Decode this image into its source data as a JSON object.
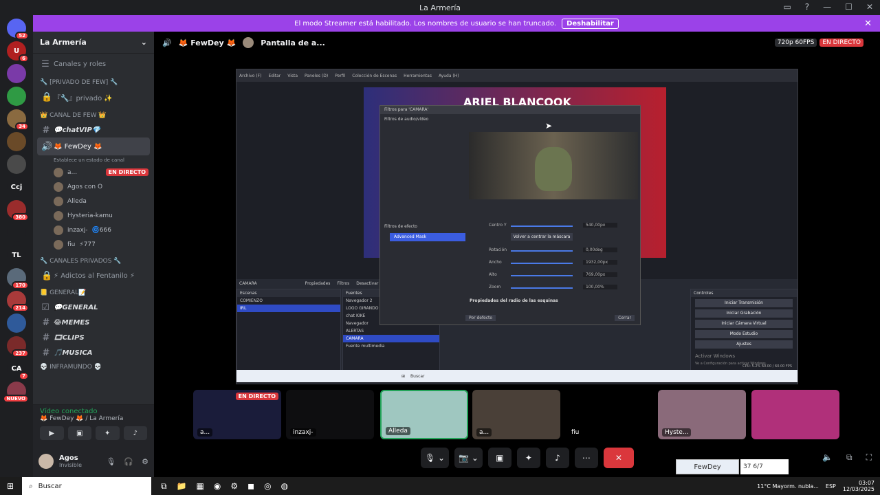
{
  "window": {
    "title": "La Armería"
  },
  "banner": {
    "text": "El modo Streamer está habilitado. Los nombres de usuario se han truncado.",
    "button": "Deshabilitar"
  },
  "servers": [
    {
      "label": "",
      "badge": "52",
      "color": "#5865f2"
    },
    {
      "label": "U",
      "badge": "6",
      "color": "#b02020"
    },
    {
      "label": "",
      "badge": "",
      "color": "#7a3aa8"
    },
    {
      "label": "",
      "badge": "",
      "color": "#2f9a44"
    },
    {
      "label": "",
      "badge": "34",
      "color": "#8a6a40"
    },
    {
      "label": "",
      "badge": "",
      "color": "#6a4a28"
    },
    {
      "label": "",
      "badge": "",
      "color": "#4a4a4a"
    },
    {
      "label": "Ccj",
      "badge": "",
      "color": "#1e1f22"
    },
    {
      "label": "",
      "badge": "380",
      "color": "#9a2c2c"
    },
    {
      "label": "",
      "badge": "",
      "color": "#1e1f22"
    },
    {
      "label": "TL",
      "badge": "",
      "color": "#1e1f22"
    },
    {
      "label": "",
      "badge": "170",
      "color": "#5a6a7a"
    },
    {
      "label": "",
      "badge": "214",
      "color": "#a83a3a"
    },
    {
      "label": "",
      "badge": "",
      "color": "#2f5a9a"
    },
    {
      "label": "",
      "badge": "237",
      "color": "#7a2a2a"
    },
    {
      "label": "CA",
      "badge": "7",
      "color": "#1e1f22"
    },
    {
      "label": "",
      "badge": "NUEVO",
      "color": "#8a3a4a"
    }
  ],
  "guild": {
    "name": "La Armería"
  },
  "channels": {
    "roles": "Canales y roles",
    "cat1": "🔧 [PRIVADO DE FEW] 🔧",
    "privado": "『🔧』privado ✨",
    "cat2": "👑 CANAL DE FEW 👑",
    "chatvip": "💬chatVIP💎",
    "voice_ch": "🦊 FewDey 🦊",
    "voice_status": "Establece un estado de canal",
    "users": [
      {
        "name": "a...",
        "live": "EN DIRECTO"
      },
      {
        "name": "Agos con O",
        "live": ""
      },
      {
        "name": "Alleda",
        "live": ""
      },
      {
        "name": "Hysteria-kamu",
        "live": ""
      },
      {
        "name": "inzaxj-",
        "extra": "🌀666",
        "live": ""
      },
      {
        "name": "fiu",
        "extra": "⚡777",
        "live": ""
      }
    ],
    "cat3": "🔧 CANALES PRIVADOS 🔧",
    "adictos": "⚡ Adictos al Fentanilo ⚡",
    "cat4": "📒 GENERAL📝",
    "general": "💬GENERAL",
    "memes": "😂MEMES",
    "clips": "🎞CLIPS",
    "musica": "🎵MUSICA",
    "cat5": "💀 INFRAMUNDO 💀"
  },
  "voice": {
    "status": "Vídeo conectado",
    "location": "🦊 FewDey 🦊 / La Armería"
  },
  "user": {
    "name": "Agos",
    "status": "Invisible"
  },
  "stage": {
    "channel": "🦊 FewDey 🦊",
    "sharing": "Pantalla de a...",
    "quality": "720p 60FPS",
    "live": "EN DIRECTO"
  },
  "obs": {
    "menu": [
      "Archivo (F)",
      "Editar",
      "Vista",
      "Paneles (D)",
      "Perfil",
      "Colección de Escenas",
      "Herramientas",
      "Ayuda (H)"
    ],
    "preview_title": "ARIEL BLANCOOK",
    "dialog_title": "Filtros para 'CAMARA'",
    "audio_filters": "Filtros de audio/vídeo",
    "effect_filters": "Filtros de efecto",
    "selected_filter": "Advanced Mask",
    "sliders": [
      {
        "label": "Centro Y",
        "value": "540,00px"
      },
      {
        "label": "Rotación",
        "value": "0,00deg"
      },
      {
        "label": "Ancho",
        "value": "1932,00px"
      },
      {
        "label": "Alto",
        "value": "769,00px"
      },
      {
        "label": "Zoom",
        "value": "100,00%"
      }
    ],
    "recenter": "Volver a centrar la máscara",
    "corner": "Propiedades del radio de las esquinas",
    "defaults": "Por defecto",
    "close": "Cerrar",
    "scenes_header": "Escenas",
    "scenes": [
      "COMIENZO",
      "IRL"
    ],
    "sources_header": "Fuentes",
    "sources": [
      "Navegador 2",
      "LOGO GIRANDO",
      "chat KIKE",
      "Navegador",
      "ALERTAS",
      "CAMARA",
      "Fuente multimedia"
    ],
    "controls_header": "Controles",
    "controls": [
      "Iniciar Transmisión",
      "Iniciar Grabación",
      "Iniciar Cámara Virtual",
      "Modo Estudio",
      "Ajustes"
    ],
    "activate": "Activar Windows",
    "activate_sub": "Ve a Configuración para activar Windows.",
    "properties": "Propiedades",
    "filters": "Filtros",
    "deactivate": "Desactivar",
    "camara_tab": "CAMARA",
    "status": "CPU: 5.2%   60.00 / 60.00 FPS",
    "search": "Buscar"
  },
  "tiles": [
    {
      "name": "a...",
      "live": "EN DIRECTO"
    },
    {
      "name": "inzaxj-",
      "live": ""
    },
    {
      "name": "Alleda",
      "live": ""
    },
    {
      "name": "a...",
      "live": ""
    },
    {
      "name": "fiu",
      "live": ""
    },
    {
      "name": "Hyste...",
      "live": ""
    },
    {
      "name": "",
      "live": ""
    }
  ],
  "overlay": {
    "name": "FewDey",
    "count": "37 6/7"
  },
  "taskbar": {
    "search": "Buscar",
    "weather": "11°C  Mayorm. nubla...",
    "lang": "ESP",
    "time": "03:07",
    "date": "12/03/2025"
  }
}
